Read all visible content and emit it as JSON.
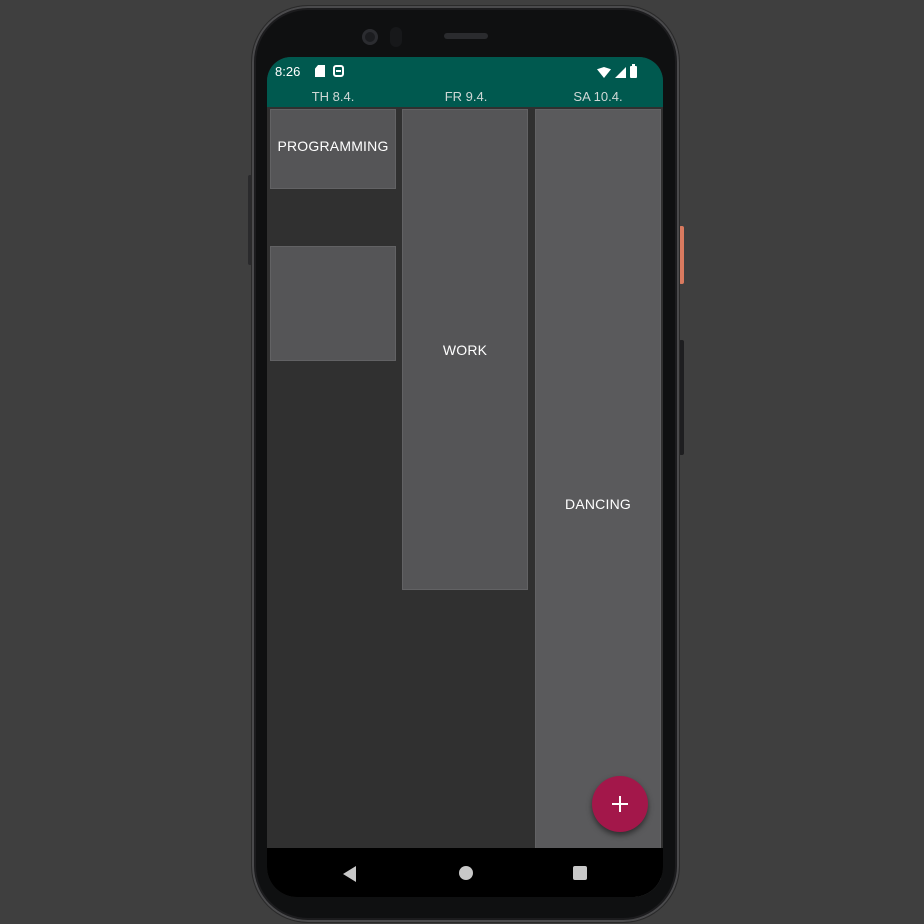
{
  "status_bar": {
    "time": "8:26",
    "left_icons": [
      "sd-card-icon",
      "s-shield-icon"
    ],
    "right_icons": [
      "wifi-icon",
      "signal-icon",
      "battery-icon"
    ]
  },
  "days": [
    {
      "label": "TH 8.4."
    },
    {
      "label": "FR 9.4."
    },
    {
      "label": "SA 10.4."
    }
  ],
  "events": [
    {
      "day": "TH 8.4.",
      "title": "PROGRAMMING"
    },
    {
      "day": "TH 8.4.",
      "title": ""
    },
    {
      "day": "FR 9.4.",
      "title": "WORK"
    },
    {
      "day": "SA 10.4.",
      "title": "DANCING"
    }
  ],
  "fab": {
    "icon": "plus-icon"
  },
  "nav_bar": {
    "icons": [
      "back-icon",
      "home-icon",
      "recents-icon"
    ]
  },
  "colors": {
    "app_bar": "#00594f",
    "background": "#303030",
    "event": "#555557",
    "fab": "#a3174a"
  }
}
